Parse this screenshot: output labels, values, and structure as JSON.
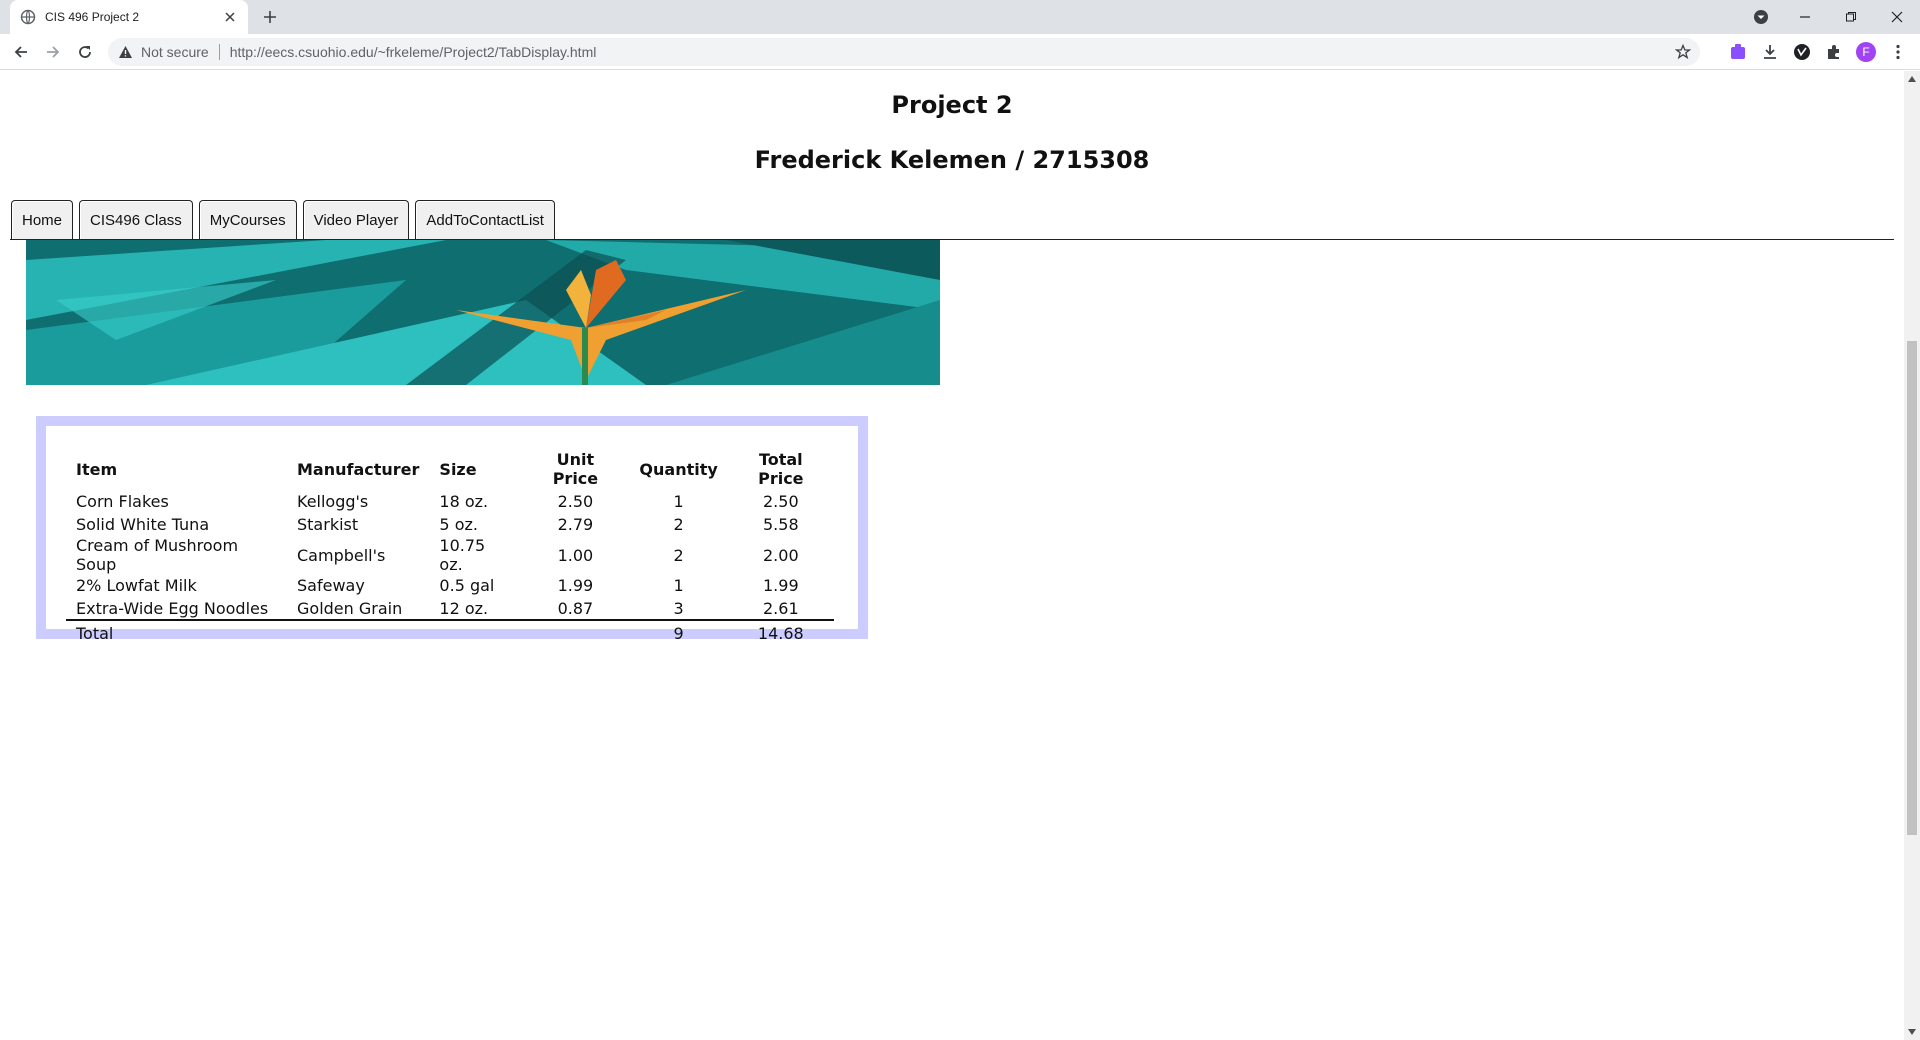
{
  "browser": {
    "tab_title": "CIS 496 Project 2",
    "security_label": "Not secure",
    "url": "http://eecs.csuohio.edu/~frkeleme/Project2/TabDisplay.html",
    "profile_initial": "F"
  },
  "page": {
    "title": "Project 2",
    "subtitle": "Frederick Kelemen / 2715308",
    "nav_tabs": [
      "Home",
      "CIS496 Class",
      "MyCourses",
      "Video Player",
      "AddToContactList"
    ]
  },
  "table": {
    "headers": [
      "Item",
      "Manufacturer",
      "Size",
      "Unit Price",
      "Quantity",
      "Total Price"
    ],
    "rows": [
      [
        "Corn Flakes",
        "Kellogg's",
        "18 oz.",
        "2.50",
        "1",
        "2.50"
      ],
      [
        "Solid White Tuna",
        "Starkist",
        "5 oz.",
        "2.79",
        "2",
        "5.58"
      ],
      [
        "Cream of Mushroom Soup",
        "Campbell's",
        "10.75 oz.",
        "1.00",
        "2",
        "2.00"
      ],
      [
        "2% Lowfat Milk",
        "Safeway",
        "0.5 gal",
        "1.99",
        "1",
        "1.99"
      ],
      [
        "Extra-Wide Egg Noodles",
        "Golden Grain",
        "12 oz.",
        "0.87",
        "3",
        "2.61"
      ]
    ],
    "total": {
      "label": "Total",
      "quantity": "9",
      "total_price": "14.68"
    }
  },
  "colors": {
    "table_border": "#ccccff",
    "banner_teal": "#1aa8a8",
    "flower_orange": "#f0a030"
  },
  "icons": [
    "globe-icon",
    "close-icon",
    "plus-icon",
    "dropdown-icon",
    "minimize-icon",
    "restore-icon",
    "back-icon",
    "forward-icon",
    "reload-icon",
    "warning-icon",
    "star-icon",
    "extension-icon",
    "download-icon",
    "puzzle-icon",
    "menu-icon"
  ]
}
